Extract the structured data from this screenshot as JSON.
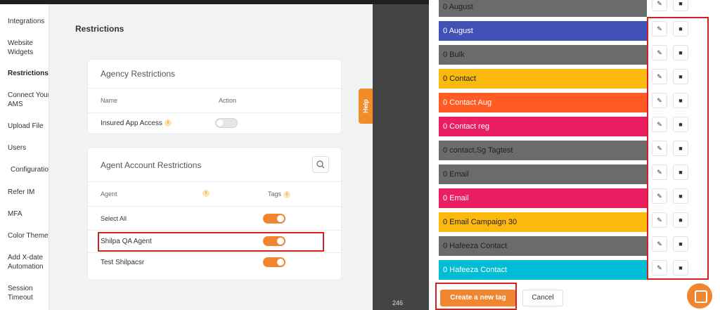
{
  "sidebar": {
    "items": [
      {
        "label": "Integrations"
      },
      {
        "label": "Website Widgets"
      },
      {
        "label": "Restrictions"
      },
      {
        "label": "Connect Your AMS"
      },
      {
        "label": "Upload File"
      },
      {
        "label": "Users"
      },
      {
        "label": "Configuration"
      },
      {
        "label": "Refer IM"
      },
      {
        "label": "MFA"
      },
      {
        "label": "Color Theme"
      },
      {
        "label": "Add X-date Automation"
      },
      {
        "label": "Session Timeout"
      }
    ]
  },
  "page": {
    "title": "Restrictions"
  },
  "agency": {
    "title": "Agency Restrictions",
    "col_name": "Name",
    "col_action": "Action",
    "rows": [
      {
        "label": "Insured App Access",
        "enabled": false
      }
    ]
  },
  "agent": {
    "title": "Agent Account Restrictions",
    "col_agent": "Agent",
    "col_tags": "Tags",
    "rows": [
      {
        "label": "Select All",
        "enabled": true
      },
      {
        "label": "Shilpa QA Agent",
        "enabled": true
      },
      {
        "label": "Test Shilpacsr",
        "enabled": true
      }
    ]
  },
  "help": {
    "label": "Help"
  },
  "pager": {
    "page": "246"
  },
  "tags": [
    {
      "name": "0 August",
      "color": "#6b6b6b"
    },
    {
      "name": "0 August",
      "color": "#4150b5"
    },
    {
      "name": "0 Bulk",
      "color": "#6b6b6b"
    },
    {
      "name": "0 Contact",
      "color": "#fbb80f"
    },
    {
      "name": "0 Contact Aug",
      "color": "#ff5b22"
    },
    {
      "name": "0 Contact reg",
      "color": "#ea1f63"
    },
    {
      "name": "0 contact,Sg Tagtest",
      "color": "#6b6b6b"
    },
    {
      "name": "0 Email",
      "color": "#6b6b6b"
    },
    {
      "name": "0 Email",
      "color": "#ea1f63"
    },
    {
      "name": "0 Email Campaign 30",
      "color": "#fbb80f"
    },
    {
      "name": "0 Hafeeza Contact",
      "color": "#6b6b6b"
    },
    {
      "name": "0 Hafeeza Contact",
      "color": "#00bcd4"
    }
  ],
  "actions": {
    "edit_icon": "pencil-icon",
    "delete_icon": "trash-icon"
  },
  "buttons": {
    "create": "Create a new tag",
    "cancel": "Cancel"
  }
}
